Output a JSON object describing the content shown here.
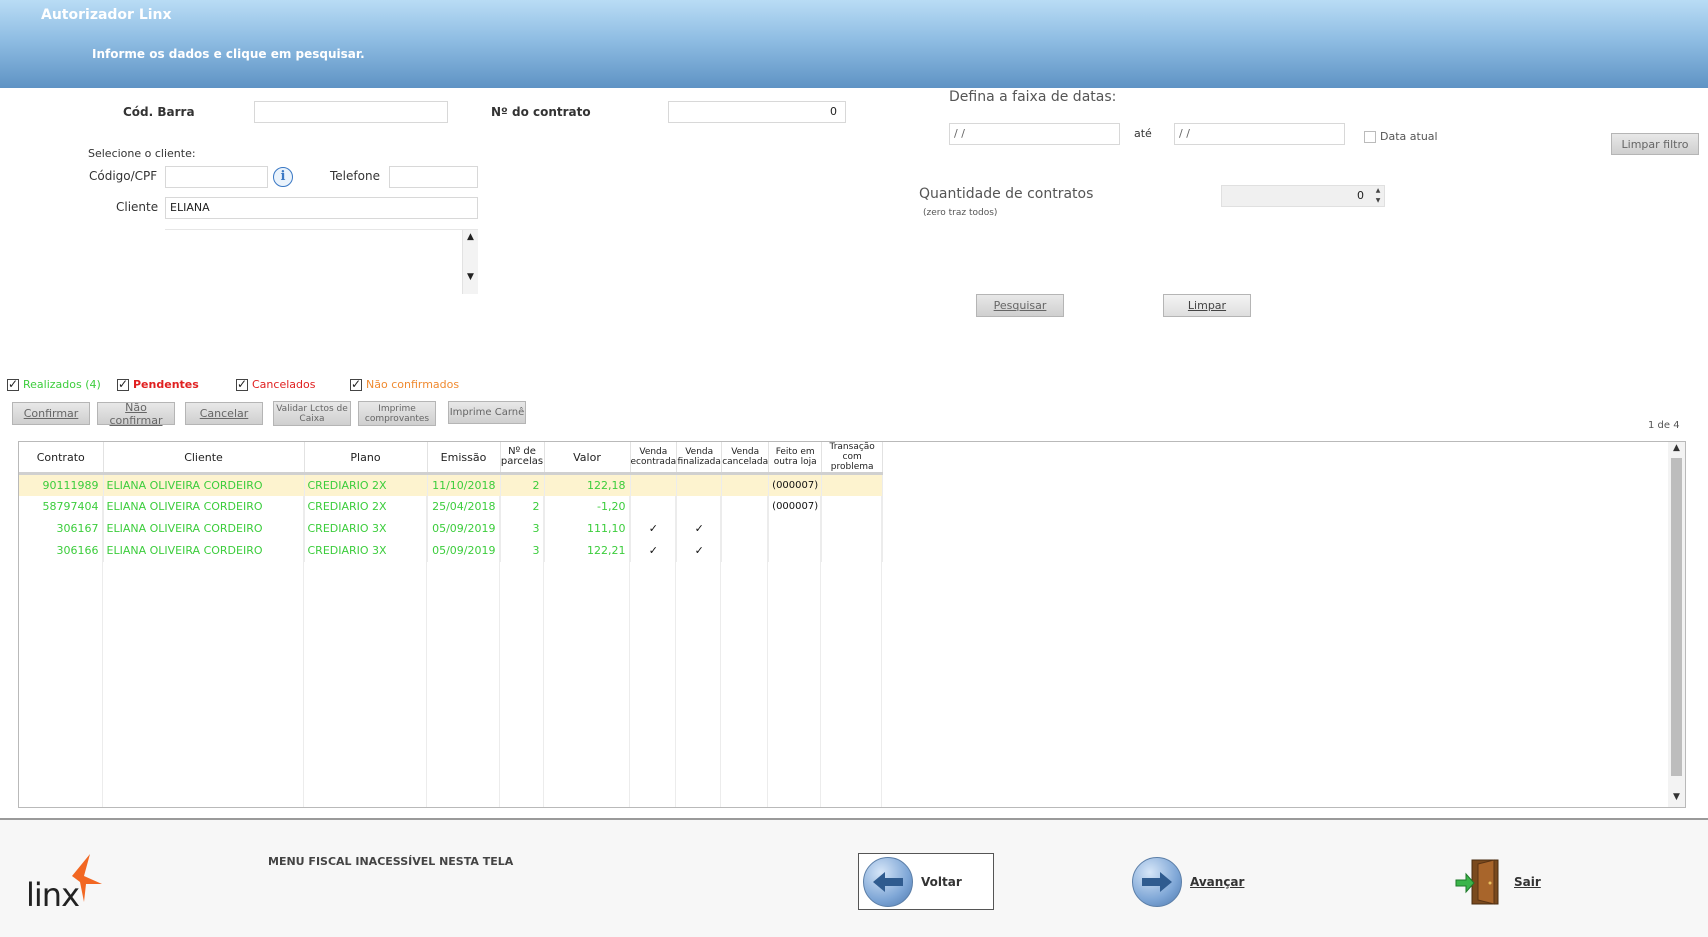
{
  "header": {
    "title": "Autorizador Linx",
    "subtitle": "Informe os dados e clique em pesquisar."
  },
  "search": {
    "cod_barra_label": "Cód. Barra",
    "cod_barra_value": "",
    "contrato_label": "Nº do contrato",
    "contrato_value": "0",
    "select_client_label": "Selecione o cliente:",
    "codigo_cpf_label": "Código/CPF",
    "codigo_cpf_value": "",
    "telefone_label": "Telefone",
    "telefone_value": "",
    "cliente_label": "Cliente",
    "cliente_value": "ELIANA"
  },
  "dates": {
    "title": "Defina a faixa de datas:",
    "from_value": " /  /",
    "ate_label": "até",
    "to_value": " /  /",
    "data_atual_label": "Data atual",
    "limpar_filtro_label": "Limpar filtro"
  },
  "quantity": {
    "label": "Quantidade de contratos",
    "hint": "(zero traz todos)",
    "value": "0"
  },
  "actions": {
    "pesquisar": "Pesquisar",
    "limpar": "Limpar"
  },
  "filters": {
    "realizados": "Realizados (4)",
    "pendentes": "Pendentes",
    "cancelados": "Cancelados",
    "nao_confirmados": "Não confirmados",
    "colors": {
      "realizados": "#3ccd3c",
      "pendentes": "#e02020",
      "cancelados": "#e02020",
      "nao_confirmados": "#f08a30"
    }
  },
  "toolbar": {
    "confirmar": "Confirmar",
    "nao_confirmar": "Não confirmar",
    "cancelar": "Cancelar",
    "validar_line1": "Validar Lctos de",
    "validar_line2": "Caixa",
    "imprime_line1": "Imprime",
    "imprime_line2": "comprovantes",
    "imprime_carne": "Imprime Carnê"
  },
  "pagination": "1 de 4",
  "grid": {
    "headers": {
      "contrato": "Contrato",
      "cliente": "Cliente",
      "plano": "Plano",
      "emissao": "Emissão",
      "parcelas_1": "Nº de",
      "parcelas_2": "parcelas",
      "valor": "Valor",
      "venda_enc_1": "Venda",
      "venda_enc_2": "econtrada",
      "venda_fin_1": "Venda",
      "venda_fin_2": "finalizada",
      "venda_can_1": "Venda",
      "venda_can_2": "cancelada",
      "feito_1": "Feito em",
      "feito_2": "outra loja",
      "trans_1": "Transação",
      "trans_2": "com problema"
    },
    "rows": [
      {
        "contrato": "90111989",
        "cliente": "ELIANA OLIVEIRA CORDEIRO",
        "plano": "CREDIARIO 2X",
        "emissao": "11/10/2018",
        "parcelas": "2",
        "valor": "122,18",
        "enc": "",
        "fin": "",
        "can": "",
        "feito": "(000007)",
        "trans": ""
      },
      {
        "contrato": "58797404",
        "cliente": "ELIANA OLIVEIRA CORDEIRO",
        "plano": "CREDIARIO 2X",
        "emissao": "25/04/2018",
        "parcelas": "2",
        "valor": "-1,20",
        "enc": "",
        "fin": "",
        "can": "",
        "feito": "(000007)",
        "trans": ""
      },
      {
        "contrato": "306167",
        "cliente": "ELIANA OLIVEIRA CORDEIRO",
        "plano": "CREDIARIO 3X",
        "emissao": "05/09/2019",
        "parcelas": "3",
        "valor": "111,10",
        "enc": "✓",
        "fin": "✓",
        "can": "",
        "feito": "",
        "trans": ""
      },
      {
        "contrato": "306166",
        "cliente": "ELIANA OLIVEIRA CORDEIRO",
        "plano": "CREDIARIO 3X",
        "emissao": "05/09/2019",
        "parcelas": "3",
        "valor": "122,21",
        "enc": "✓",
        "fin": "✓",
        "can": "",
        "feito": "",
        "trans": ""
      }
    ]
  },
  "footer": {
    "logo_text": "linx",
    "fiscal_msg": "MENU FISCAL INACESSÍVEL NESTA TELA",
    "voltar": "Voltar",
    "avancar": "Avançar",
    "sair": "Sair"
  }
}
